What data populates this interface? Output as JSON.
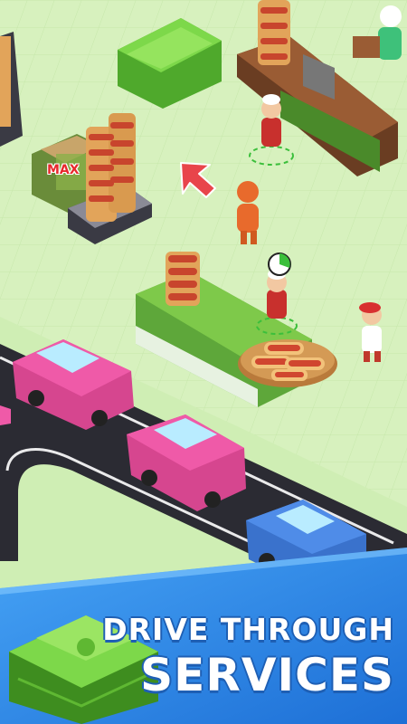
{
  "screen": "Hot dog stand drive-through game promo",
  "machine": {
    "max_label": "MAX"
  },
  "banner": {
    "line1": "DRIVE THROUGH",
    "line2": "SERVICES"
  },
  "colors": {
    "grass": "#d7f1be",
    "road": "#2b2b33",
    "car_pink": "#ef5aa8",
    "car_blue": "#4f8ce8",
    "money_green": "#7dd84a",
    "banner_blue": "#2f86e6",
    "counter_green": "#7ec94a",
    "arrow_red": "#e8454b"
  },
  "icons": [
    "money-stack-icon",
    "hotdog-icon",
    "arrow-pointer-icon",
    "progress-ring-icon"
  ]
}
